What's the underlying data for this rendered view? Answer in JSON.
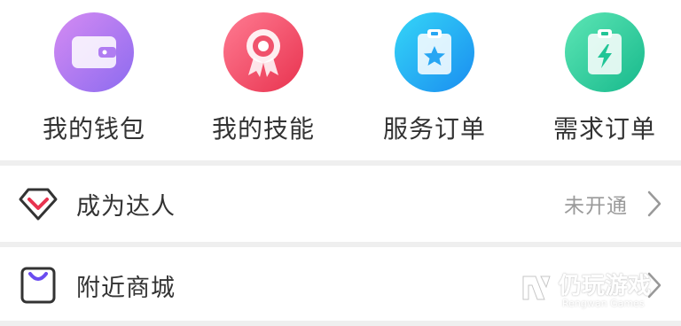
{
  "grid": {
    "items": [
      {
        "label": "我的钱包",
        "icon": "wallet-icon",
        "color_from": "#d58bf2",
        "color_to": "#8c6bf0"
      },
      {
        "label": "我的技能",
        "icon": "badge-icon",
        "color_from": "#ff7b92",
        "color_to": "#e8334f"
      },
      {
        "label": "服务订单",
        "icon": "service-order-icon",
        "color_from": "#35d6f7",
        "color_to": "#1a8df0"
      },
      {
        "label": "需求订单",
        "icon": "demand-order-icon",
        "color_from": "#5de6b5",
        "color_to": "#17b98c"
      }
    ]
  },
  "list": {
    "items": [
      {
        "label": "成为达人",
        "status": "未开通",
        "icon": "diamond-icon",
        "icon_color": "#e8334f"
      },
      {
        "label": "附近商城",
        "status": "",
        "icon": "shopping-bag-icon",
        "icon_color": "#6a4cf0"
      }
    ]
  },
  "watermark": {
    "title": "仍玩游戏",
    "subtitle": "Rengwan Games"
  }
}
